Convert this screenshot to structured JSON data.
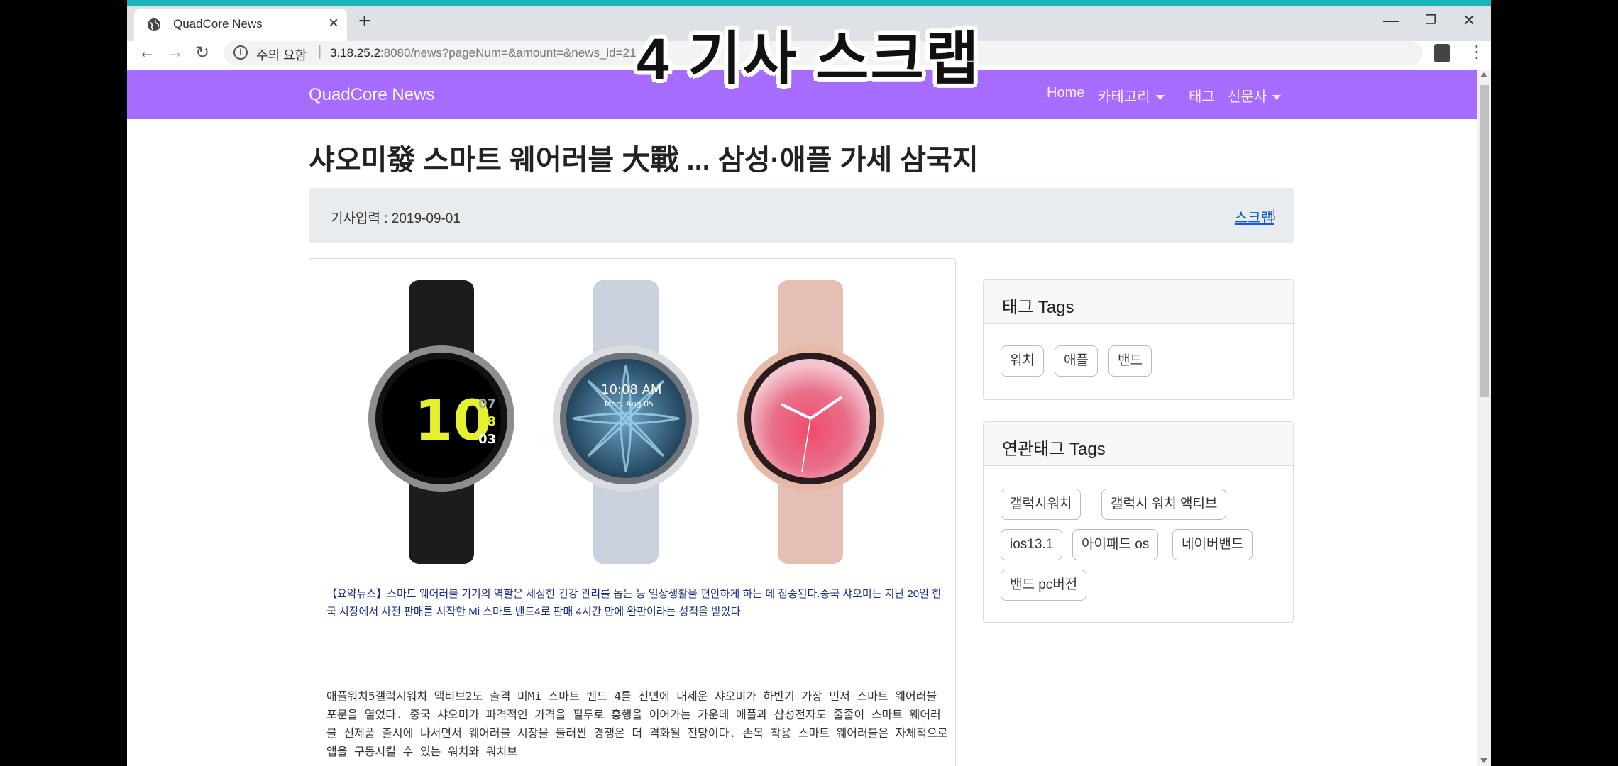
{
  "browser": {
    "tab_title": "QuadCore News",
    "new_tab": "+",
    "security_warning": "주의 요함",
    "url_host": "3.18.25.2",
    "url_rest": ":8080/news?pageNum=&amount=&news_id=21",
    "window_controls": [
      "minimize-icon",
      "restore-icon",
      "close-icon"
    ]
  },
  "caption": "4 기사 스크랩",
  "site": {
    "brand": "QuadCore News",
    "nav": {
      "home": "Home",
      "category": "카테고리",
      "tag": "태그",
      "newspaper": "신문사"
    },
    "accent_color": "#a66bff"
  },
  "article": {
    "title": "샤오미發 스마트 웨어러블 大戰 ... 삼성·애플 가세 삼국지",
    "date_label": "기사입력 : 2019-09-01",
    "scrap_link": "스크랩",
    "summary": "【요약뉴스】스마트 웨어러블 기기의 역할은 세심한 건강 관리를 돕는 등 일상생활을 편안하게 하는 데 집중된다.중국 샤오미는 지난 20일 한국 시장에서 사전 판매를 시작한 Mi 스마트 밴드4로 판매 4시간 만에 완판이라는 성적을 받았다",
    "body": "애플워치5갤럭시워치 액티브2도 출격 미Mi 스마트 밴드 4를 전면에 내세운 샤오미가 하반기 가장 먼저 스마트 웨어러블 포문을 열었다. 중국 샤오미가 파격적인 가격을 필두로 흥행을 이어가는 가운데 애플과 삼성전자도 줄줄이 스마트 웨어러블 신제품 출시에 나서면서 웨어러블 시장을 둘러싼 경쟁은 더 격화될 전망이다. 손목 착용 스마트 웨어러블은 자체적으로 앱을 구동시킬 수 있는 워치와 워치보",
    "watch_faces": {
      "black_time": "10",
      "black_side": [
        "07",
        "08",
        "03"
      ],
      "silver_time": "10:08 AM",
      "silver_date": "Mon, Aug 05"
    }
  },
  "tags_card": {
    "title": "태그 Tags",
    "tags": [
      "워치",
      "애플",
      "밴드"
    ]
  },
  "related_card": {
    "title": "연관태그 Tags",
    "tags": [
      "갤럭시워치",
      "갤럭시 워치 액티브",
      "ios13.1",
      "아이패드 os",
      "네이버밴드",
      "밴드 pc버전"
    ]
  }
}
